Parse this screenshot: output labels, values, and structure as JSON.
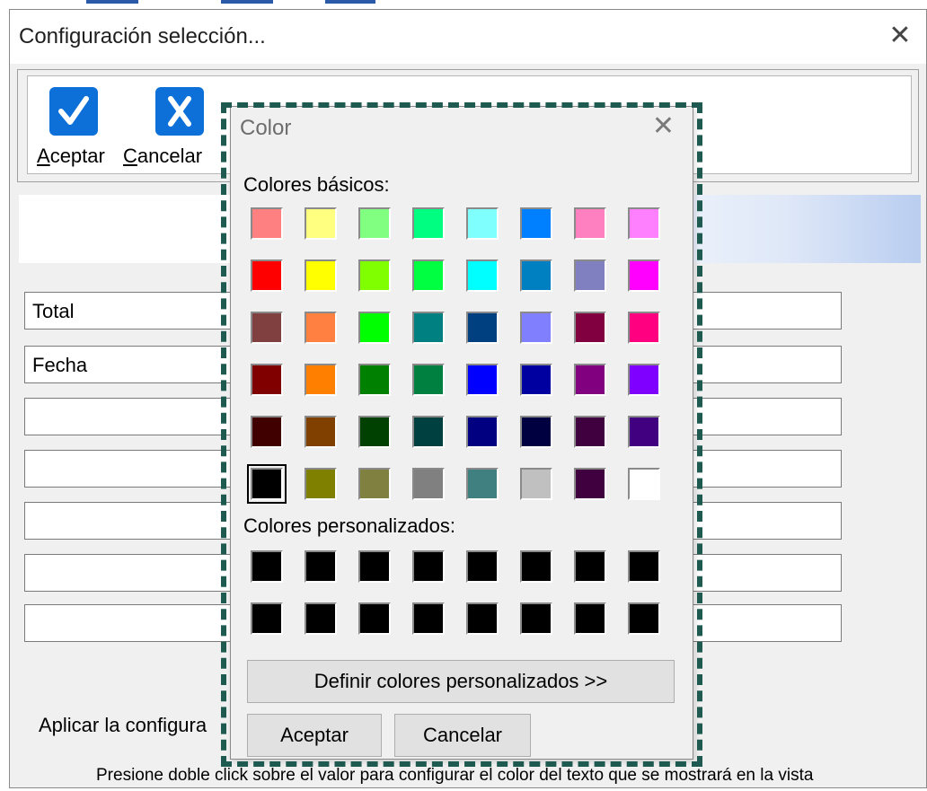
{
  "colors": {
    "accent": "#0d6fd8",
    "dashed_outline": "#1e5a50"
  },
  "parent": {
    "title": "Configuración selección...",
    "close_icon": "close-icon",
    "toolbar": {
      "accept_underline": "A",
      "accept_rest": "ceptar",
      "cancel_underline": "C",
      "cancel_rest": "ancelar"
    },
    "fields": [
      "Total",
      "Fecha",
      "",
      "",
      "",
      "",
      ""
    ],
    "apply_label": "Aplicar la configura",
    "hint": "Presione doble click sobre el valor para configurar el color del texto que se mostrará en la vista"
  },
  "color_dialog": {
    "title": "Color",
    "close_icon": "close-icon",
    "basic_label": "Colores básicos:",
    "custom_label": "Colores personalizados:",
    "basic_colors": [
      [
        "#FF8080",
        "#FFFF80",
        "#80FF80",
        "#00FF80",
        "#80FFFF",
        "#0080FF",
        "#FF80C0",
        "#FF80FF"
      ],
      [
        "#FF0000",
        "#FFFF00",
        "#80FF00",
        "#00FF40",
        "#00FFFF",
        "#0080C0",
        "#8080C0",
        "#FF00FF"
      ],
      [
        "#804040",
        "#FF8040",
        "#00FF00",
        "#008080",
        "#004080",
        "#8080FF",
        "#800040",
        "#FF0080"
      ],
      [
        "#800000",
        "#FF8000",
        "#008000",
        "#008040",
        "#0000FF",
        "#0000A0",
        "#800080",
        "#8000FF"
      ],
      [
        "#400000",
        "#804000",
        "#004000",
        "#004040",
        "#000080",
        "#000040",
        "#400040",
        "#400080"
      ],
      [
        "#000000",
        "#808000",
        "#808040",
        "#808080",
        "#408080",
        "#C0C0C0",
        "#400040",
        "#FFFFFF"
      ]
    ],
    "selected_basic": [
      5,
      0
    ],
    "custom_colors": [
      [
        "#000000",
        "#000000",
        "#000000",
        "#000000",
        "#000000",
        "#000000",
        "#000000",
        "#000000"
      ],
      [
        "#000000",
        "#000000",
        "#000000",
        "#000000",
        "#000000",
        "#000000",
        "#000000",
        "#000000"
      ]
    ],
    "define_button": "Definir colores personalizados >>",
    "accept_button": "Aceptar",
    "cancel_button": "Cancelar"
  }
}
